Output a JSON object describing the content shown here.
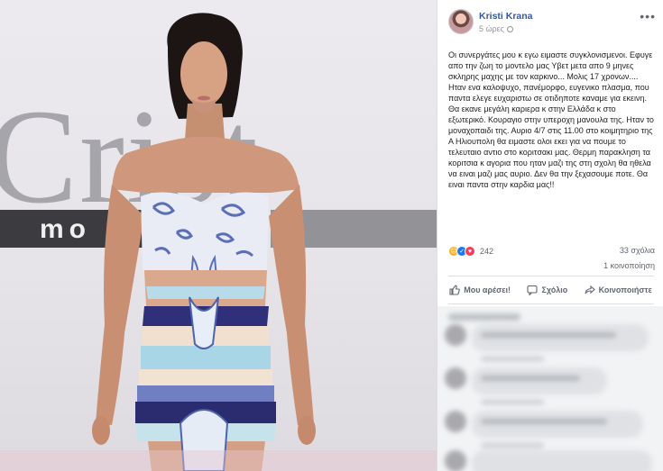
{
  "photo": {
    "brand_text": "Crist",
    "brand_sub": "mo"
  },
  "post": {
    "author": "Kristi Krana",
    "time": "5 ώρες",
    "more_icon": "more-icon",
    "text": "Οι συνεργάτες μου κ εγω ειμαστε συγκλονισμενοι. Εφυγε απο την ζωη το μοντελο μας Υβετ μετα απο 9 μηνες σκληρης μαχης με τον καρκινο... Μολις 17 χρονων.... Ηταν ενα καλοψυχο, πανέμορφο, ευγενικο πλασμα, που παντα ελεγε ευχαριστω σε οτιδηποτε καναμε για εκεινη. Θα εκανε μεγάλη καριερα κ στην Ελλάδα κ στο εξωτερικό. Κουραγιο στην υπεροχη μανουλα της. Ηταν το μοναχοπαιδι της. Αυριο 4/7 στις 11.00 στο κοιμητηριο της Α Ηλιουπολη θα ειμαστε ολοι εκει για να πουμε το τελευταιο αντιο στο κοριτσακι μας. Θερμη παρακληση τα κοριτσια κ αγορια που ηταν μαζι της στη σχολη θα ηθελα να ειναι μαζι μας αυριο. Δεν θα την ξεχασουμε ποτε. Θα ειναι παντα στην καρδια μας!!",
    "reaction_count": "242",
    "comments": "33 σχόλια",
    "shares": "1 κοινοποίηση",
    "actions": {
      "like": "Μου αρέσει!",
      "comment": "Σχόλιο",
      "share": "Κοινοποιήστε"
    }
  },
  "colors": {
    "link": "#385898",
    "secondary": "#606770",
    "like": "#1877f2",
    "love": "#f33e58",
    "sad": "#f7b125"
  }
}
